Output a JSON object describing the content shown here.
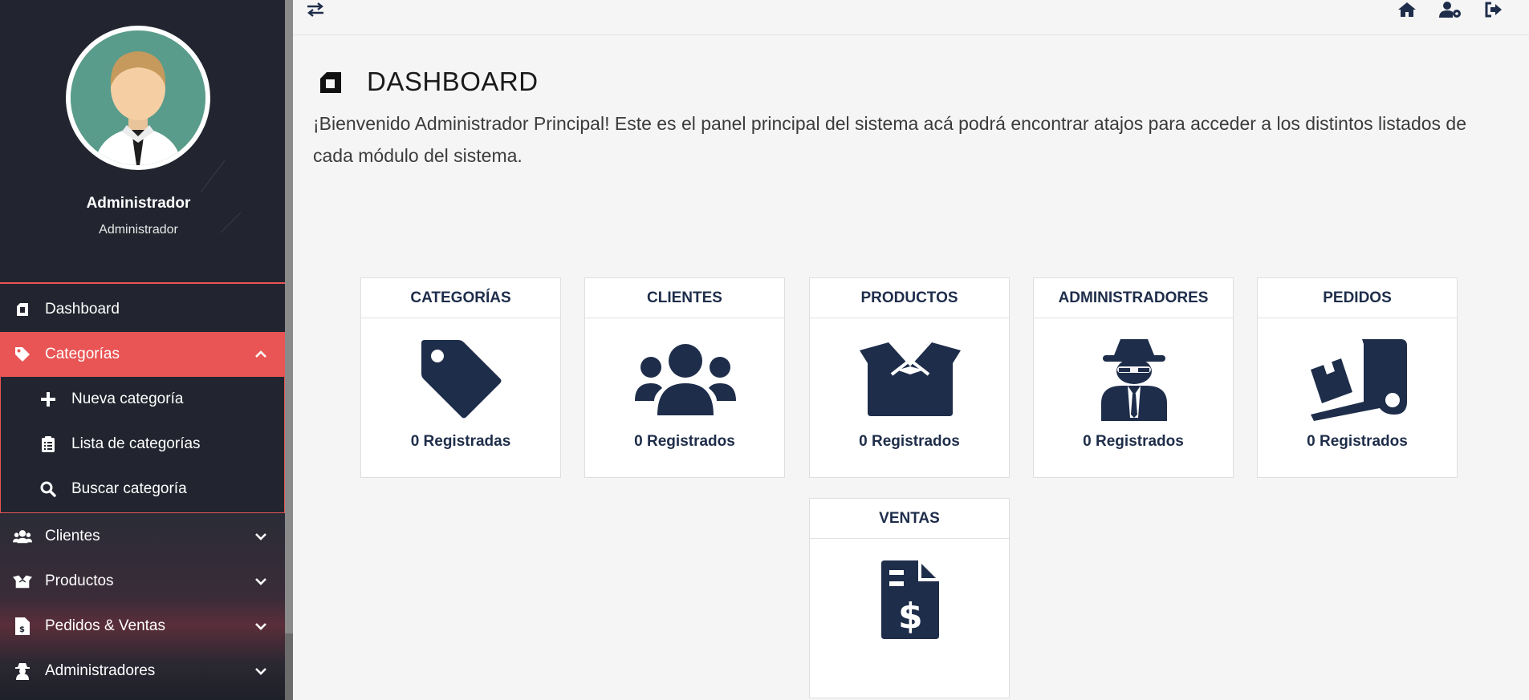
{
  "colors": {
    "sidebar_bg": "#22252f",
    "accent": "#e95454",
    "icon_navy": "#1e2d4a"
  },
  "profile": {
    "name": "Administrador",
    "role": "Administrador"
  },
  "menu": {
    "dashboard": "Dashboard",
    "categorias": "Categorías",
    "submenu": {
      "nueva": "Nueva categoría",
      "lista": "Lista de categorías",
      "buscar": "Buscar categoría"
    },
    "clientes": "Clientes",
    "productos": "Productos",
    "pedidos_ventas": "Pedidos & Ventas",
    "administradores": "Administradores"
  },
  "topbar": {
    "icons": [
      "swap-arrows-icon",
      "home-icon",
      "user-settings-icon",
      "logout-icon"
    ]
  },
  "main": {
    "title": "DASHBOARD",
    "intro": "¡Bienvenido Administrador Principal! Este es el panel principal del sistema acá podrá encontrar atajos para acceder a los distintos listados de cada módulo del sistema."
  },
  "cards": [
    {
      "title": "CATEGORÍAS",
      "count": "0 Registradas",
      "icon": "tag-icon"
    },
    {
      "title": "CLIENTES",
      "count": "0 Registrados",
      "icon": "users-icon"
    },
    {
      "title": "PRODUCTOS",
      "count": "0 Registrados",
      "icon": "box-open-icon"
    },
    {
      "title": "ADMINISTRADORES",
      "count": "0 Registrados",
      "icon": "user-secret-icon"
    },
    {
      "title": "PEDIDOS",
      "count": "0 Registrados",
      "icon": "dolly-icon"
    },
    {
      "title": "VENTAS",
      "count": "",
      "icon": "invoice-dollar-icon"
    }
  ]
}
